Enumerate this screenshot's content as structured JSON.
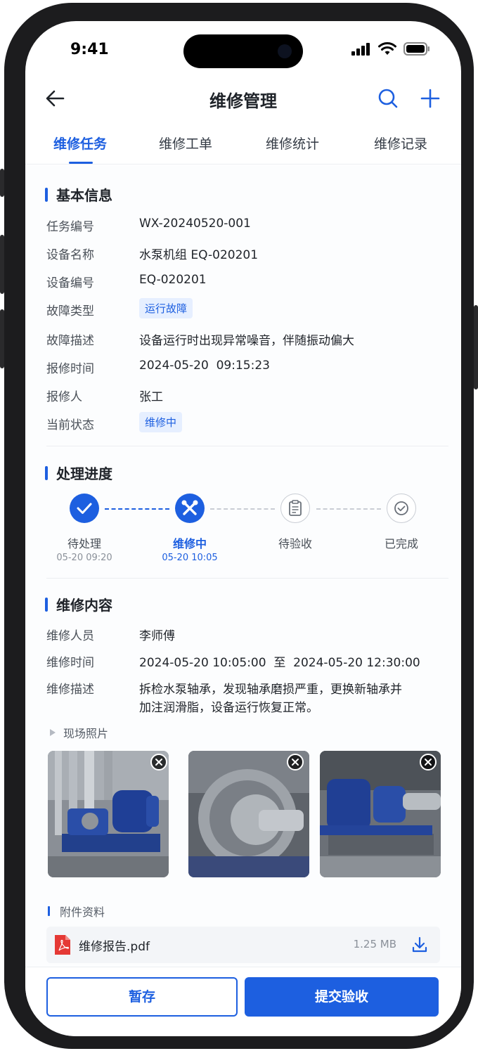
{
  "status_bar": {
    "time": "9:41"
  },
  "nav": {
    "title": "维修管理"
  },
  "tabs": [
    {
      "label": "维修任务",
      "active": true
    },
    {
      "label": "维修工单",
      "active": false
    },
    {
      "label": "维修统计",
      "active": false
    },
    {
      "label": "维修记录",
      "active": false
    }
  ],
  "basic_info": {
    "title": "基本信息",
    "rows": [
      {
        "label": "任务编号",
        "value": "WX-20240520-001"
      },
      {
        "label": "设备名称",
        "value": "水泵机组 EQ-020201"
      },
      {
        "label": "设备编号",
        "value": "EQ-020201"
      },
      {
        "label": "故障类型",
        "value": "运行故障",
        "tag": true
      },
      {
        "label": "故障描述",
        "value": "设备运行时出现异常噪音，伴随振动偏大"
      },
      {
        "label": "报修时间",
        "value": "2024-05-20  09:15:23"
      },
      {
        "label": "报修人",
        "value": "张工"
      },
      {
        "label": "当前状态",
        "value": "维修中",
        "tag": true
      }
    ]
  },
  "progress": {
    "title": "处理进度",
    "steps": [
      {
        "label": "待处理",
        "time": "05-20 09:20",
        "state": "done",
        "icon": "check-icon"
      },
      {
        "label": "维修中",
        "time": "05-20 10:05",
        "state": "current",
        "icon": "wrench-icon"
      },
      {
        "label": "待验收",
        "time": "",
        "state": "pending",
        "icon": "clipboard-icon"
      },
      {
        "label": "已完成",
        "time": "",
        "state": "pending",
        "icon": "check-circle-icon"
      }
    ]
  },
  "repair": {
    "title": "维修内容",
    "personnel_label": "维修人员",
    "personnel": "李师傅",
    "time_label": "维修时间",
    "time": "2024-05-20 10:05:00  至  2024-05-20 12:30:00",
    "desc_label": "维修描述",
    "desc_line1": "拆检水泵轴承，发现轴承磨损严重，更换新轴承并",
    "desc_line2": "加注润滑脂，设备运行恢复正常。",
    "photos_label": "现场照片",
    "attachments_label": "附件资料",
    "attachment": {
      "name": "维修报告.pdf",
      "size": "1.25 MB"
    }
  },
  "colors": {
    "accent": "#1d5fe0",
    "tag_bg": "#e6efff",
    "pdf": "#e53935"
  },
  "footer": {
    "save_label": "暂存",
    "submit_label": "提交验收"
  }
}
